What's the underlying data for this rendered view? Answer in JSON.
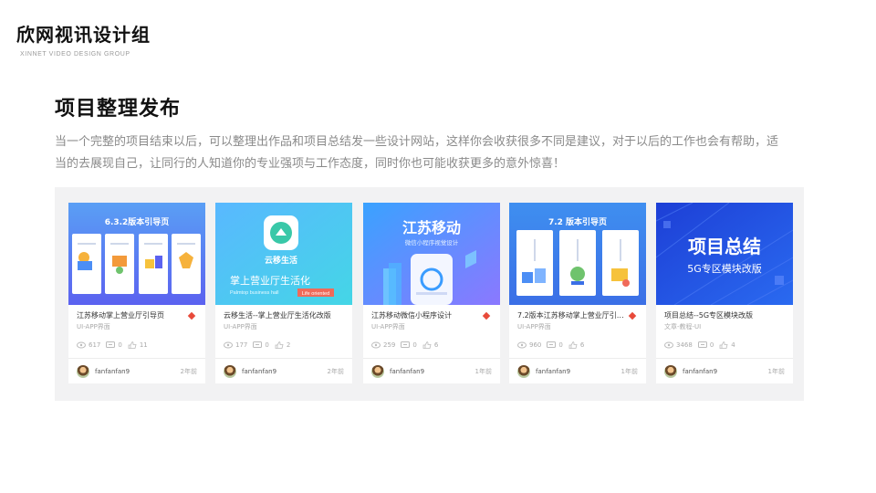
{
  "brand": {
    "title": "欣网视讯设计组",
    "subtitle": "XINNET VIDEO DESIGN GROUP"
  },
  "section": {
    "title": "项目整理发布",
    "description": "当一个完整的项目结束以后，可以整理出作品和项目总结发一些设计网站，这样你会收获很多不同是建议，对于以后的工作也会有帮助，适当的去展现自己，让同行的人知道你的专业强项与工作态度，同时你也可能收获更多的意外惊喜！"
  },
  "colors": {
    "hot_badge": "#e84a3a",
    "panel_bg": "#f2f2f3"
  },
  "cards": [
    {
      "thumb_text": "6.3.2版本引导页",
      "title": "江苏移动掌上营业厅引导页",
      "category": "UI-APP界面",
      "views": "617",
      "comments": "0",
      "likes": "11",
      "author": "fanfanfan9",
      "ago": "2年前",
      "hot": true
    },
    {
      "thumb_text": "云移生活",
      "thumb_headline": "掌上营业厅生活化",
      "thumb_sub": "Palmtop business hall",
      "thumb_tag": "Life oriented",
      "title": "云移生活--掌上营业厅生活化改版",
      "category": "UI-APP界面",
      "views": "177",
      "comments": "0",
      "likes": "2",
      "author": "fanfanfan9",
      "ago": "2年前",
      "hot": false
    },
    {
      "thumb_text": "江苏移动",
      "thumb_sub": "微信小程序视觉设计",
      "title": "江苏移动微信小程序设计",
      "category": "UI-APP界面",
      "views": "259",
      "comments": "0",
      "likes": "6",
      "author": "fanfanfan9",
      "ago": "1年前",
      "hot": true
    },
    {
      "thumb_text": "7.2 版本引导页",
      "title": "7.2版本江苏移动掌上营业厅引导页",
      "category": "UI-APP界面",
      "views": "960",
      "comments": "0",
      "likes": "6",
      "author": "fanfanfan9",
      "ago": "1年前",
      "hot": true
    },
    {
      "thumb_text": "项目总结",
      "thumb_sub": "5G专区模块改版",
      "title": "项目总结--5G专区模块改版",
      "category": "文章-教程-UI",
      "views": "3468",
      "comments": "0",
      "likes": "4",
      "author": "fanfanfan9",
      "ago": "1年前",
      "hot": false
    }
  ]
}
